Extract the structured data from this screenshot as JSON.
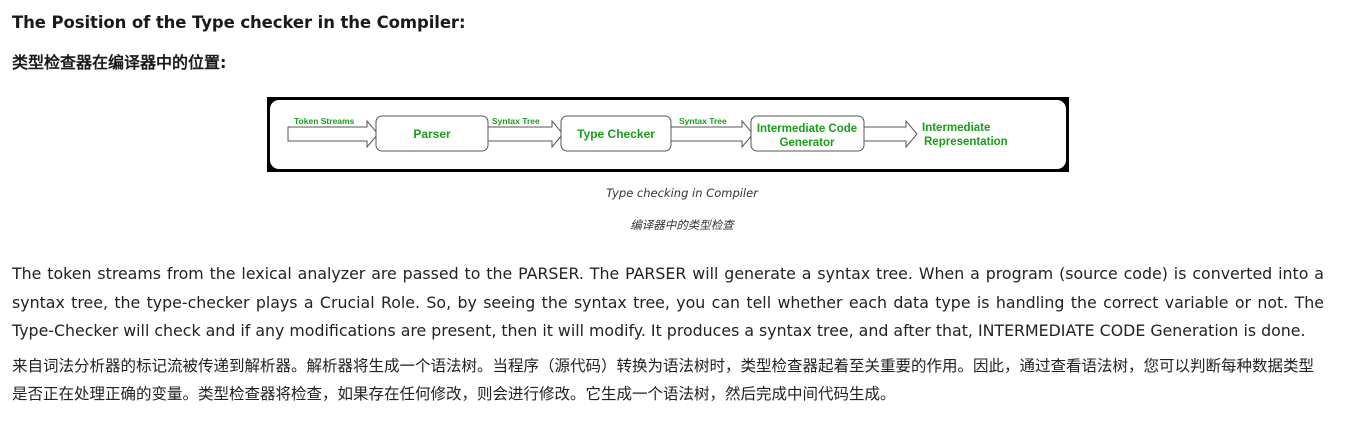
{
  "heading_en": "The Position of the Type checker in the Compiler:",
  "heading_zh": "类型检查器在编译器中的位置:",
  "diagram": {
    "edges": {
      "token_streams": "Token Streams",
      "syntax_tree_1": "Syntax Tree",
      "syntax_tree_2": "Syntax Tree"
    },
    "nodes": {
      "parser": "Parser",
      "type_checker": "Type Checker",
      "icg_line1": "Intermediate Code",
      "icg_line2": "Generator",
      "ir_line1": "Intermediate",
      "ir_line2": "Representation"
    },
    "colors": {
      "text": "#16a016",
      "frame": "#000000"
    }
  },
  "caption_en": "Type checking in Compiler",
  "caption_zh": "编译器中的类型检查",
  "paragraph_en": "The token streams from the lexical analyzer are passed to the PARSER. The PARSER will generate a syntax tree. When a program (source code) is converted into a syntax tree, the type-checker plays a Crucial Role. So, by seeing the syntax tree, you can tell whether each data type is handling the correct variable or not. The Type-Checker will check and if any modifications are present, then it will modify. It produces a syntax tree, and after that, INTERMEDIATE CODE Generation is done.",
  "paragraph_zh": "来自词法分析器的标记流被传递到解析器。解析器将生成一个语法树。当程序（源代码）转换为语法树时，类型检查器起着至关重要的作用。因此，通过查看语法树，您可以判断每种数据类型是否正在处理正确的变量。类型检查器将检查，如果存在任何修改，则会进行修改。它生成一个语法树，然后完成中间代码生成。"
}
